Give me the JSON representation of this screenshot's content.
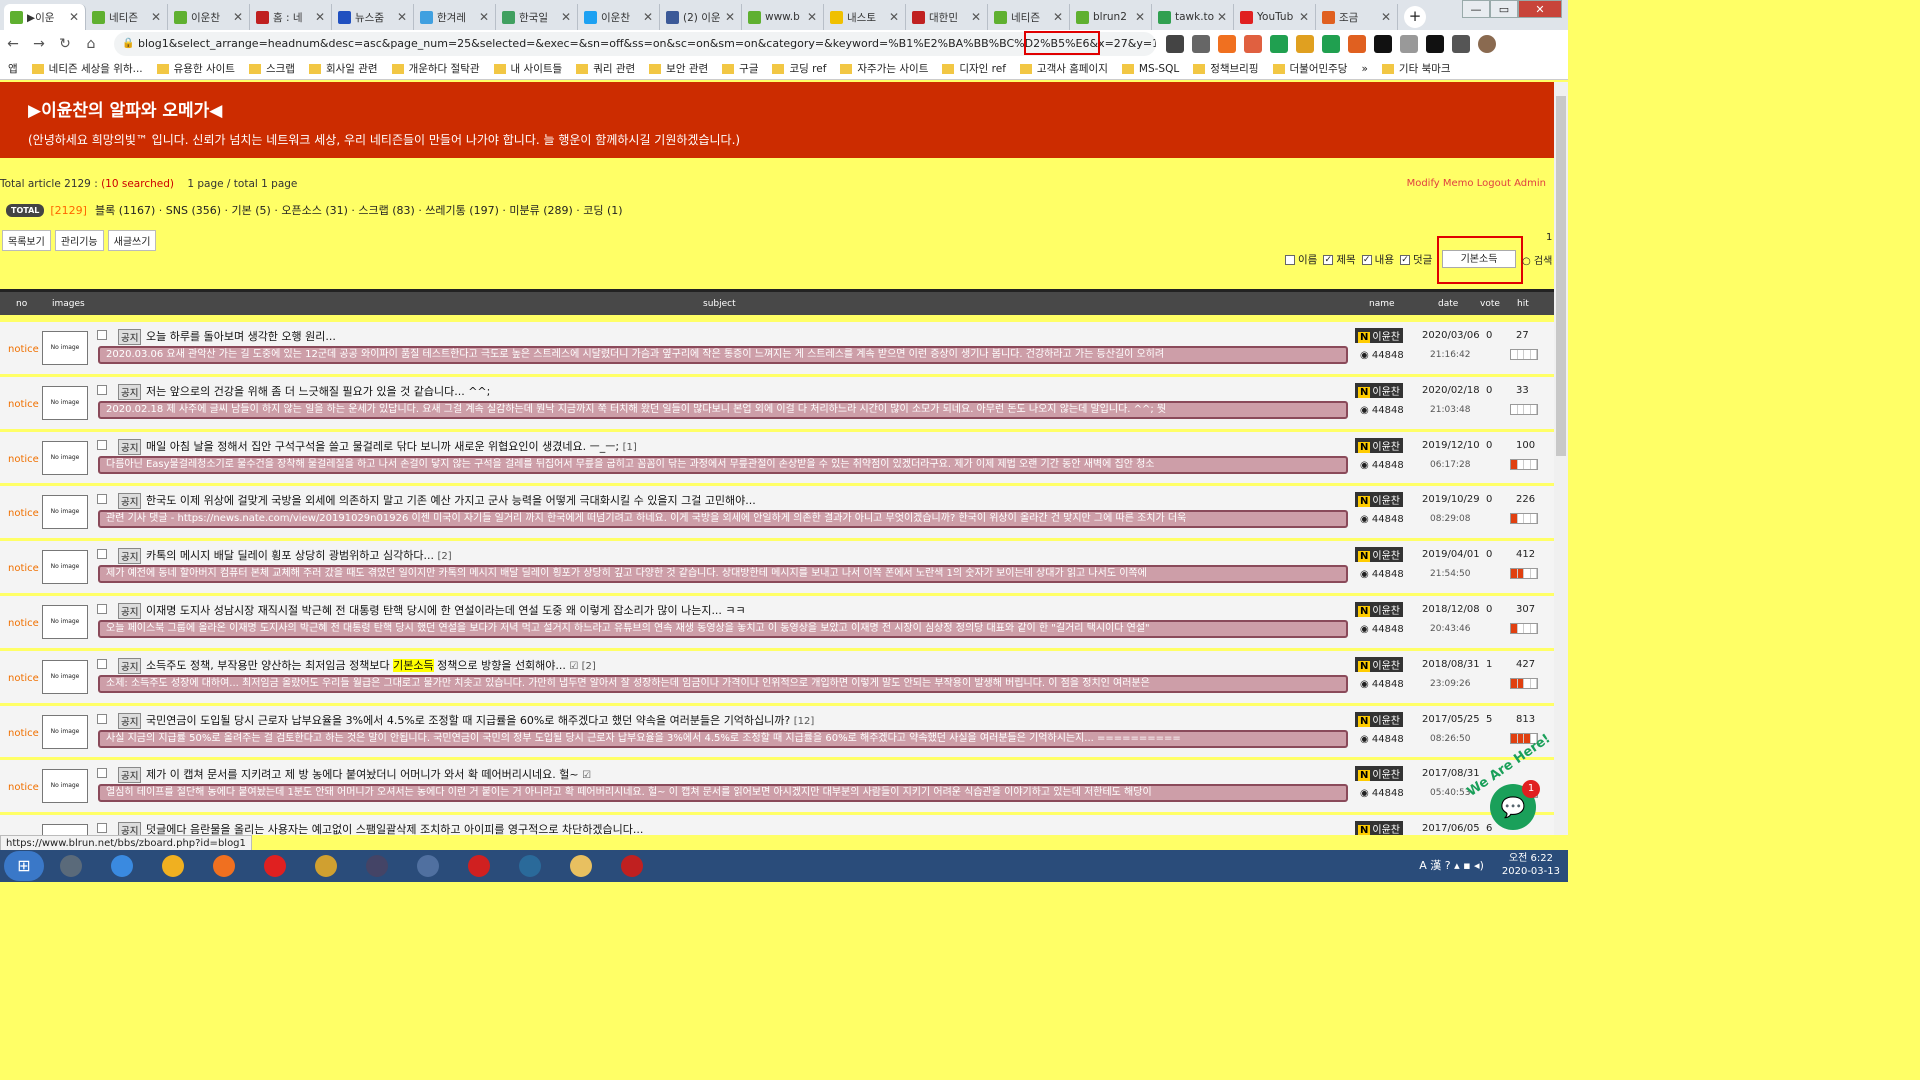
{
  "browser": {
    "tabs": [
      {
        "label": "▶이운",
        "color": "#5fb030",
        "active": true
      },
      {
        "label": "네티즌",
        "color": "#5fb030"
      },
      {
        "label": "이운찬",
        "color": "#5fb030"
      },
      {
        "label": "홈 : 네",
        "color": "#c02020"
      },
      {
        "label": "뉴스줌",
        "color": "#2050c0"
      },
      {
        "label": "한겨레",
        "color": "#40a0e0"
      },
      {
        "label": "한국일",
        "color": "#40a060"
      },
      {
        "label": "이운찬",
        "color": "#1da1f2"
      },
      {
        "label": "(2) 이운",
        "color": "#3b5998"
      },
      {
        "label": "www.b",
        "color": "#5fb030"
      },
      {
        "label": "내스토",
        "color": "#f0c000"
      },
      {
        "label": "대한민",
        "color": "#c02020"
      },
      {
        "label": "네티즌",
        "color": "#5fb030"
      },
      {
        "label": "blrun2",
        "color": "#5fb030"
      },
      {
        "label": "tawk.to",
        "color": "#30a050"
      },
      {
        "label": "YouTub",
        "color": "#e02020"
      },
      {
        "label": "조금 ",
        "color": "#e06020"
      }
    ],
    "new_tab": "+",
    "url": "blog1&select_arrange=headnum&desc=asc&page_num=25&selected=&exec=&sn=off&ss=on&sc=on&sm=on&category=&keyword=%B1%E2%BA%BB%BC%D2%B5%E6&x=27&y=13",
    "bookmarks": [
      "앱",
      "네티즌 세상을 위하...",
      "유용한 사이트",
      "스크랩",
      "회사일 관련",
      "개운하다 절탁관",
      "내 사이트들",
      "쿼리 관련",
      "보안 관련",
      "구글",
      "코딩 ref",
      "자주가는 사이트",
      "디자인 ref",
      "고객사 홈페이지",
      "MS-SQL",
      "정책브리핑",
      "더불어민주당",
      "»",
      "기타 북마크"
    ],
    "status_url": "https://www.blrun.net/bbs/zboard.php?id=blog1"
  },
  "board": {
    "title": "▶이윤찬의 알파와 오메가◀",
    "greeting": "(안녕하세요 희망의빛™ 입니다. 신뢰가 넘치는 네트워크 세상, 우리 네티즌들이 만들어 나가야 합니다. 늘 행운이 함께하시길 기원하겠습니다.)",
    "stats_prefix": "Total article 2129 : ",
    "stats_searched": "(10 searched)",
    "stats_page": "1 page / total 1 page",
    "admin_links": "Modify  Memo  Logout  Admin",
    "total_badge": "TOTAL",
    "total_count": "[2129]",
    "categories": "블록 (1167) · SNS (356) · 기본 (5) · 오픈소스 (31) · 스크랩 (83) · 쓰레기통 (197) · 미분류 (289) · 코딩 (1)",
    "buttons": [
      "목록보기",
      "관리기능",
      "새글쓰기"
    ],
    "page_indicator": "1",
    "search": {
      "options": [
        {
          "label": "이름",
          "checked": false
        },
        {
          "label": "제목",
          "checked": true
        },
        {
          "label": "내용",
          "checked": true
        },
        {
          "label": "덧글",
          "checked": true
        }
      ],
      "value": "기본소득",
      "button": "검색"
    },
    "columns": {
      "no": "no",
      "images": "images",
      "subject": "subject",
      "name": "name",
      "date": "date",
      "vote": "vote",
      "hit": "hit"
    },
    "posts": [
      {
        "notice": "notice",
        "tag": "공지",
        "subject": "오늘 하루를 돌아보며 생각한 오행 원리...",
        "comments": "",
        "preview": "2020.03.06 요새 관악산 가는 길 도중에 있는 12군데 공공 와이파이 품질 테스트한다고 극도로 높은 스트레스에 시달렸더니 가슴과 옆구리에 작은 통증이 느껴지는 게 스트레스를 계속 받으면 이런 증상이 생기나 봅니다. 건강하라고 가는 등산길이 오히려",
        "name": "이윤찬",
        "views": "44848",
        "date": "2020/03/06",
        "time": "21:16:42",
        "vote": "0",
        "hit": "27",
        "bars": 0
      },
      {
        "notice": "notice",
        "tag": "공지",
        "subject": "저는 앞으로의 건강을 위해 좀 더 느긋해질 필요가 있을 것 같습니다... ^^;",
        "comments": "",
        "preview": "2020.02.18 제 사주에 글씨 남들이 하지 않는 일을 하는 운세가 있답니다. 요새 그걸 계속 실감하는데 뭔낙 지금까지 쭉 터치해 왔던 일들이 많다보니 본업 외에 이걸 다 처리하느라 시간이 많이 소모가 되네요. 아무런 돈도 나오지 않는데 말입니다. ^^; 뭣",
        "name": "이윤찬",
        "views": "44848",
        "date": "2020/02/18",
        "time": "21:03:48",
        "vote": "0",
        "hit": "33",
        "bars": 0
      },
      {
        "notice": "notice",
        "tag": "공지",
        "subject": "매일 아침 날을 정해서 집안 구석구석을 쓸고 물걸레로 닦다 보니까 새로운 위협요인이 생겼네요. ㅡ_ㅡ;",
        "comments": "[1]",
        "preview": "다름아닌 Easy물걸레청소기로 물수건을 장착해 물걸레질을 하고 나서 손걸이 닿지 않는 구석을 걸레를 뒤집어서 무릎을 굽히고 꼼꼼이 닦는 과정에서 무릎관절이 손상받을 수 있는 취약점이 있겠더라구요. 제가 이제 제법 오랜 기간 동안 새벽에 집안 청소",
        "name": "이윤찬",
        "views": "44848",
        "date": "2019/12/10",
        "time": "06:17:28",
        "vote": "0",
        "hit": "100",
        "bars": 1
      },
      {
        "notice": "notice",
        "tag": "공지",
        "subject": "한국도 이제 위상에 걸맞게 국방을 외세에 의존하지 말고 기존 예산 가지고 군사 능력을 어떻게 극대화시킬 수 있을지 그걸 고민해야...",
        "comments": "",
        "preview": "관련 기사 댓글 - https://news.nate.com/view/20191029n01926 이젠 미국이 자기들 일거리 까지 한국에게 떠넘기려고 하네요. 이게 국방을 외세에 안일하게 의존한 결과가 아니고 무엇이겠습니까? 한국이 위상이 올라간 건 맞지만 그에 따른 조치가 더욱",
        "name": "이윤찬",
        "views": "44848",
        "date": "2019/10/29",
        "time": "08:29:08",
        "vote": "0",
        "hit": "226",
        "bars": 1
      },
      {
        "notice": "notice",
        "tag": "공지",
        "subject": "카톡의 메시지 배달 딜레이 횡포 상당히 광범위하고 심각하다...",
        "comments": "[2]",
        "preview": "제가 예전에 동네 할아버지 컴퓨터 본체 교체해 주러 갔을 때도 겪었던 일이지만 카톡의 메시지 배달 딜레이 횡포가 상당히 깊고 다양한 것 같습니다. 상대방한테 메시지를 보내고 나서 이쪽 폰에서 노란색 1의 숫자가 보이는데 상대가 읽고 나서도 이쪽에",
        "name": "이윤찬",
        "views": "44848",
        "date": "2019/04/01",
        "time": "21:54:50",
        "vote": "0",
        "hit": "412",
        "bars": 2
      },
      {
        "notice": "notice",
        "tag": "공지",
        "subject": "이재명 도지사 성남시장 재직시절 박근혜 전 대통령 탄핵 당시에 한 연설이라는데 연설 도중 왜 이렇게 잡소리가 많이 나는지... ㅋㅋ",
        "comments": "",
        "preview": "오늘 페이스북 그룹에 올라온 이재명 도지사의 박근혜 전 대통령 탄핵 당시 했던 연설을 보다가 저녁 먹고 설거지 하느라고 유튜브의 연속 재생 동영상을 놓치고 이 동영상을 보았고 이재명 전 시장이 심상정 정의당 대표와 같이 한 \"길거리 택시이다 연설\"",
        "name": "이윤찬",
        "views": "44848",
        "date": "2018/12/08",
        "time": "20:43:46",
        "vote": "0",
        "hit": "307",
        "bars": 1
      },
      {
        "notice": "notice",
        "tag": "공지",
        "subject_before": "소득주도 정책, 부작용만 양산하는 최저임금 정책보다 ",
        "subject_hl": "기본소득",
        "subject_after": " 정책으로 방향을 선회해야...",
        "comments": "☑ [2]",
        "preview": "소제: 소득주도 성장에 대하여... 최저임금 올랐어도 우리들 월급은 그대로고 물가만 치솟고 있습니다. 가만히 냅두면 알아서 잘 성장하는데 임금이나 가격이나 인위적으로 개입하면 이렇게 말도 안되는 부작용이 발생해 버립니다. 이 점을 정치인 여러분은",
        "name": "이윤찬",
        "views": "44848",
        "date": "2018/08/31",
        "time": "23:09:26",
        "vote": "1",
        "hit": "427",
        "bars": 2
      },
      {
        "notice": "notice",
        "tag": "공지",
        "subject": "국민연금이 도입될 당시 근로자 납부요율을 3%에서 4.5%로 조정할 때 지급률을 60%로 해주겠다고 했던 약속을 여러분들은 기억하십니까?",
        "comments": "[12]",
        "preview": "사실 지금의 지급률 50%로 올려주는 걸 검토한다고 하는 것은 말이 안됩니다. 국민연금이 국민의 정부 도입될 당시 근로자 납부요율을 3%에서 4.5%로 조정할 때 지급률을 60%로 해주겠다고 약속했던 사실을 여러분들은 기억하시는지... ==========",
        "name": "이윤찬",
        "views": "44848",
        "date": "2017/05/25",
        "time": "08:26:50",
        "vote": "5",
        "hit": "813",
        "bars": 3
      },
      {
        "notice": "notice",
        "tag": "공지",
        "subject": "제가 이 캡쳐 문서를 지키려고 제 방 농에다 붙여놨더니 어머니가 와서 확 떼어버리시네요. 헐~",
        "comments": "☑",
        "preview": "열심히 테이프를 절단해 농에다 붙여놨는데 1분도 안돼 어머니가 오셔서는 농에다 이런 거 붙이는 거 아니라고 확 떼어버리시네요. 헐~ 이 캡쳐 문서를 읽어보면 아시겠지만 대부분의 사람들이 지키기 어려운 식습관을 이야기하고 있는데 저한테도 해당이",
        "name": "이윤찬",
        "views": "44848",
        "date": "2017/08/31",
        "time": "05:40:53",
        "vote": "",
        "hit": "",
        "bars": 0
      },
      {
        "notice": "notice",
        "tag": "공지",
        "subject": "덧글에다 음란물을 올리는 사용자는 예고없이 스팸일괄삭제 조치하고 아이피를 영구적으로 차단하겠습니다...",
        "comments": "",
        "preview": "",
        "name": "이윤찬",
        "views": "44848",
        "date": "2017/06/05",
        "time": "",
        "vote": "6",
        "hit": "",
        "bars": 0
      }
    ]
  },
  "widget": {
    "badge": "1",
    "caption": "We Are Here!"
  },
  "taskbar": {
    "apps": [
      "#5a6a7a",
      "#3a8ae0",
      "#f0b020",
      "#f07020",
      "#e02020",
      "#d0a030",
      "#444466",
      "#5070a0",
      "#d02020",
      "#2a6a9a",
      "#e8c060",
      "#c02020"
    ],
    "tray_symbols": "A 漢 ? ▴ ▪ ◂)",
    "time": "오전 6:22",
    "date": "2020-03-13"
  },
  "colors": {
    "accent_red": "#cc2c00",
    "board_bg": "#ffff66",
    "preview_bg": "#cd9ea8",
    "notice": "#f07000"
  }
}
